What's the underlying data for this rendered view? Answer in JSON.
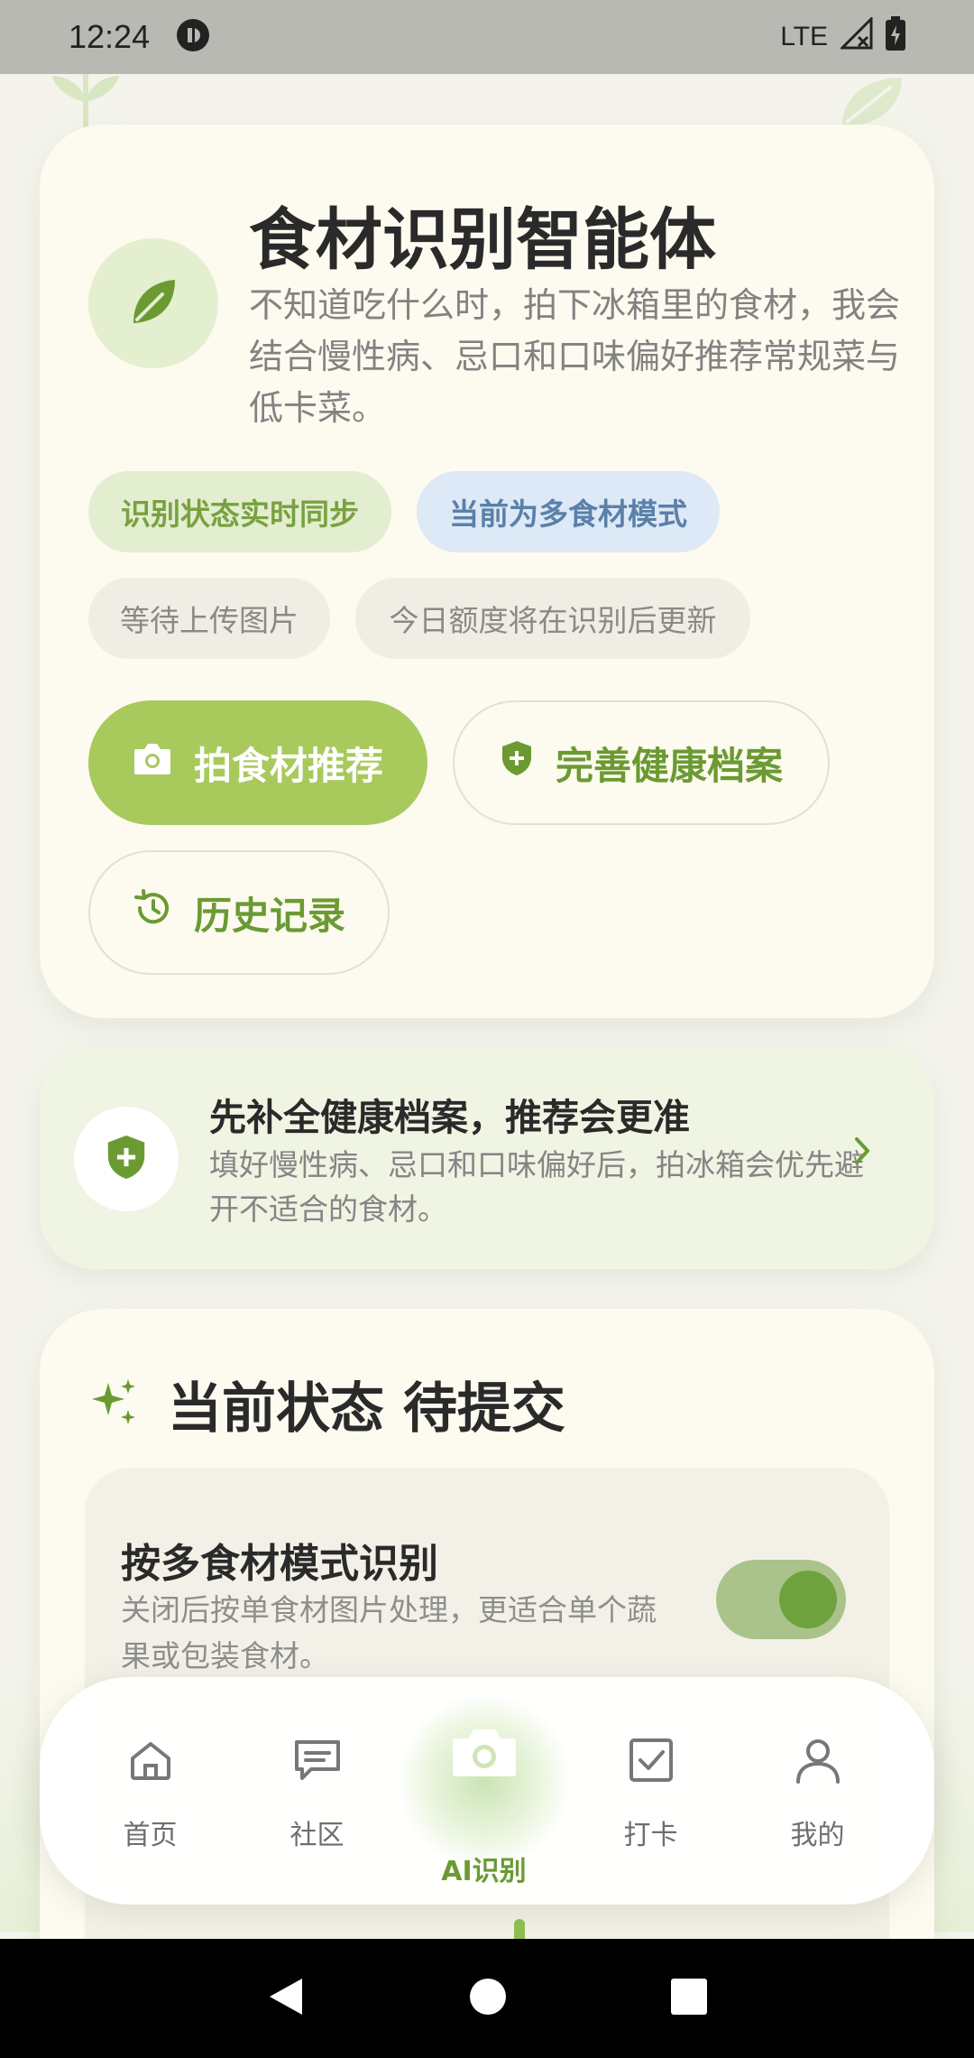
{
  "status_bar": {
    "time": "12:24",
    "network": "LTE"
  },
  "hero": {
    "title": "食材识别智能体",
    "description": "不知道吃什么时，拍下冰箱里的食材，我会结合慢性病、忌口和口味偏好推荐常规菜与低卡菜。",
    "chips": {
      "sync": "识别状态实时同步",
      "mode": "当前为多食材模式",
      "waiting": "等待上传图片",
      "quota": "今日额度将在识别后更新"
    },
    "buttons": {
      "photo": "拍食材推荐",
      "health": "完善健康档案",
      "history": "历史记录"
    }
  },
  "tip": {
    "title": "先补全健康档案，推荐会更准",
    "description": "填好慢性病、忌口和口味偏好后，拍冰箱会优先避开不适合的食材。"
  },
  "status_card": {
    "title": "当前状态 待提交",
    "multi_mode": {
      "title": "按多食材模式识别",
      "description": "关闭后按单食材图片处理，更适合单个蔬果或包装食材。",
      "enabled": true
    }
  },
  "bottom_nav": {
    "items": [
      {
        "label": "首页",
        "icon": "home-icon"
      },
      {
        "label": "社区",
        "icon": "chat-icon"
      },
      {
        "label": "AI识别",
        "icon": "camera-icon",
        "active": true
      },
      {
        "label": "打卡",
        "icon": "checkbox-icon"
      },
      {
        "label": "我的",
        "icon": "person-icon"
      }
    ]
  },
  "colors": {
    "accent": "#a8c95c",
    "accent_text": "#6b9a33",
    "card_bg": "#fdfaef",
    "page_bg": "#f4f4ec"
  }
}
